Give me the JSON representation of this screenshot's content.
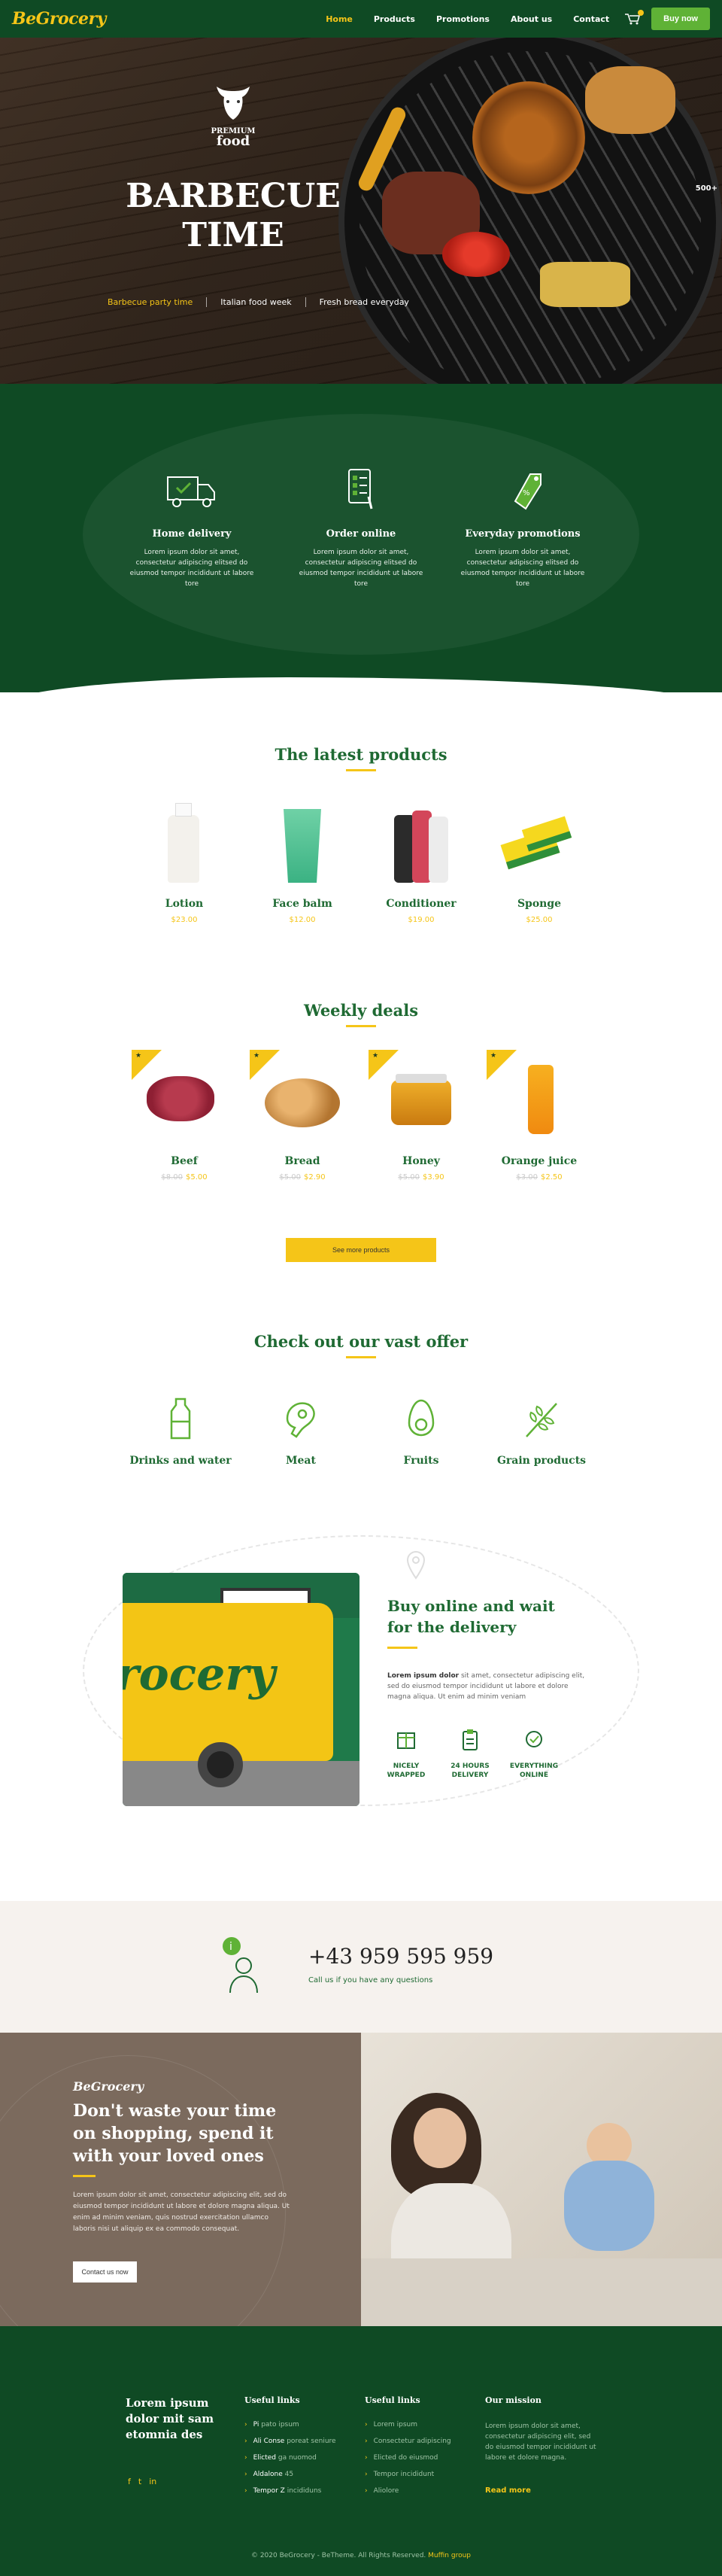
{
  "header": {
    "logo": "BeGrocery",
    "nav": [
      "Home",
      "Products",
      "Promotions",
      "About us",
      "Contact"
    ],
    "buy_now": "Buy now"
  },
  "hero": {
    "badge_top": "PREMIUM",
    "badge_bottom": "food",
    "title_line1": "BARBECUE",
    "title_line2": "TIME",
    "tabs": [
      "Barbecue party time",
      "Italian food week",
      "Fresh bread everyday"
    ],
    "side_badge": "500+"
  },
  "services": [
    {
      "title": "Home delivery",
      "text": "Lorem ipsum dolor sit amet, consectetur adipiscing elitsed do eiusmod tempor incididunt ut labore tore",
      "icon": "truck-icon"
    },
    {
      "title": "Order online",
      "text": "Lorem ipsum dolor sit amet, consectetur adipiscing elitsed do eiusmod tempor incididunt ut labore tore",
      "icon": "checklist-icon"
    },
    {
      "title": "Everyday promotions",
      "text": "Lorem ipsum dolor sit amet, consectetur adipiscing elitsed do eiusmod tempor incididunt ut labore tore",
      "icon": "tag-icon"
    }
  ],
  "latest": {
    "title": "The latest products",
    "items": [
      {
        "name": "Lotion",
        "price": "$23.00"
      },
      {
        "name": "Face balm",
        "price": "$12.00"
      },
      {
        "name": "Conditioner",
        "price": "$19.00"
      },
      {
        "name": "Sponge",
        "price": "$25.00"
      }
    ]
  },
  "weekly": {
    "title": "Weekly deals",
    "items": [
      {
        "name": "Beef",
        "old": "$8.00",
        "price": "$5.00"
      },
      {
        "name": "Bread",
        "old": "$5.00",
        "price": "$2.90"
      },
      {
        "name": "Honey",
        "old": "$5.00",
        "price": "$3.90"
      },
      {
        "name": "Orange juice",
        "old": "$3.00",
        "price": "$2.50"
      }
    ],
    "see_more": "See more products"
  },
  "offer": {
    "title": "Check out our vast offer",
    "items": [
      {
        "label": "Drinks and water",
        "icon": "bottle-icon"
      },
      {
        "label": "Meat",
        "icon": "meat-icon"
      },
      {
        "label": "Fruits",
        "icon": "avocado-icon"
      },
      {
        "label": "Grain products",
        "icon": "wheat-icon"
      }
    ]
  },
  "delivery": {
    "title_line1": "Buy online and wait",
    "title_line2": "for the delivery",
    "text_bold": "Lorem ipsum dolor",
    "text": " sit amet, consectetur adipiscing elit, sed do eiusmod tempor incididunt ut labore et dolore magna aliqua. Ut enim ad minim veniam",
    "van_text": "rocery",
    "features": [
      {
        "line1": "NICELY",
        "line2": "WRAPPED",
        "icon": "box-icon"
      },
      {
        "line1": "24 HOURS",
        "line2": "DELIVERY",
        "icon": "clipboard-icon"
      },
      {
        "line1": "EVERYTHING",
        "line2": "ONLINE",
        "icon": "badge-icon"
      }
    ]
  },
  "phone": {
    "number": "+43 959 595 959",
    "sub": "Call us if you have any questions"
  },
  "promo": {
    "logo": "BeGrocery",
    "title": "Don't waste your time on shopping, spend it with your loved ones",
    "text": "Lorem ipsum dolor sit amet, consectetur adipiscing elit, sed do eiusmod tempor incididunt ut labore et dolore magna aliqua. Ut enim ad minim veniam, quis nostrud exercitation ullamco laboris nisi ut aliquip ex ea commodo consequat.",
    "button": "Contact us now"
  },
  "footer": {
    "tagline": "Lorem ipsum dolor mit sam etomnia des",
    "col1_title": "Useful links",
    "col1": [
      {
        "a": "Pi",
        "b": " pato ipsum"
      },
      {
        "a": "Ali Conse",
        "b": " poreat seniure"
      },
      {
        "a": "Elicted",
        "b": " ga nuomod"
      },
      {
        "a": "Aldalone",
        "b": " 45"
      },
      {
        "a": "Tempor Z",
        "b": " incididuns"
      }
    ],
    "col2_title": "Useful links",
    "col2": [
      {
        "a": "",
        "b": "Lorem ipsum"
      },
      {
        "a": "",
        "b": "Consectetur adipiscing"
      },
      {
        "a": "",
        "b": "Elicted do eiusmod"
      },
      {
        "a": "",
        "b": "Tempor incididunt"
      },
      {
        "a": "",
        "b": "Aliolore"
      }
    ],
    "col3_title": "Our mission",
    "col3_text": "Lorem ipsum dolor sit amet, consectetur adipiscing elit, sed do eiusmod tempor incididunt ut labore et dolore magna.",
    "read_more": "Read more",
    "copyright": "© 2020 BeGrocery - BeTheme. All Rights Reserved.",
    "copyright_brand": "Muffin group"
  },
  "colors": {
    "green_dark": "#0f4a24",
    "green_text": "#1f6a33",
    "accent_yellow": "#f5c518",
    "button_green": "#5fb236"
  }
}
